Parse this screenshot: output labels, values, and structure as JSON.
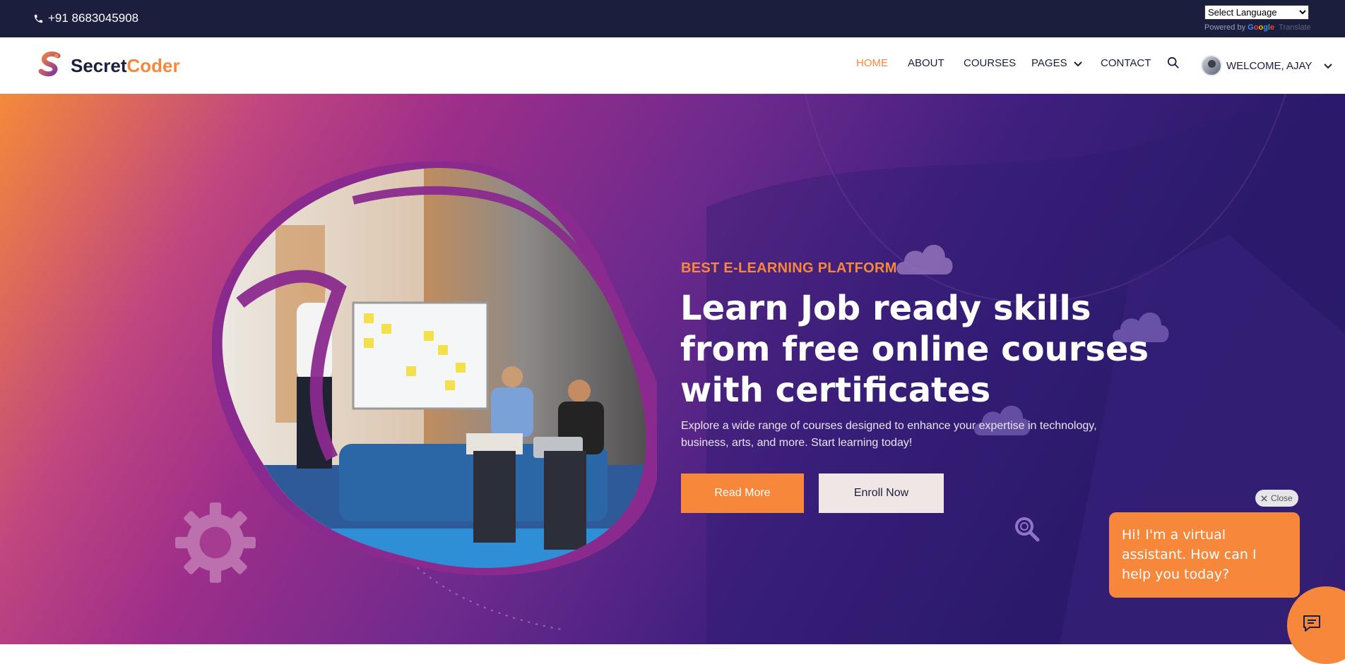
{
  "topbar": {
    "phone": "+91 8683045908",
    "language_select": "Select Language",
    "powered_by": "Powered by",
    "google": [
      "G",
      "o",
      "o",
      "g",
      "l",
      "e"
    ],
    "translate": "Translate"
  },
  "brand": {
    "part1": "Secret",
    "part2": "Coder"
  },
  "nav": {
    "home": "HOME",
    "about": "ABOUT",
    "courses": "COURSES",
    "pages": "PAGES",
    "contact": "CONTACT",
    "user": "WELCOME, AJAY"
  },
  "hero": {
    "subtitle": "BEST E-LEARNING PLATFORM",
    "headline": "Learn Job ready skills from free online courses with certificates",
    "description": "Explore a wide range of courses designed to enhance your expertise in technology, business, arts, and more. Start learning today!",
    "read_more": "Read More",
    "enroll_now": "Enroll Now"
  },
  "chat": {
    "close": "Close",
    "message": "Hi! I'm a virtual assistant. How can I help you today?"
  },
  "colors": {
    "accent": "#f7883b",
    "dark": "#1b1f3d",
    "hero_start": "#f48a3a",
    "hero_end": "#2a1866"
  },
  "icons": [
    "phone-icon",
    "chevron-down-icon",
    "search-icon",
    "gear-icon",
    "magnifier-icon",
    "chat-icon",
    "close-icon"
  ]
}
